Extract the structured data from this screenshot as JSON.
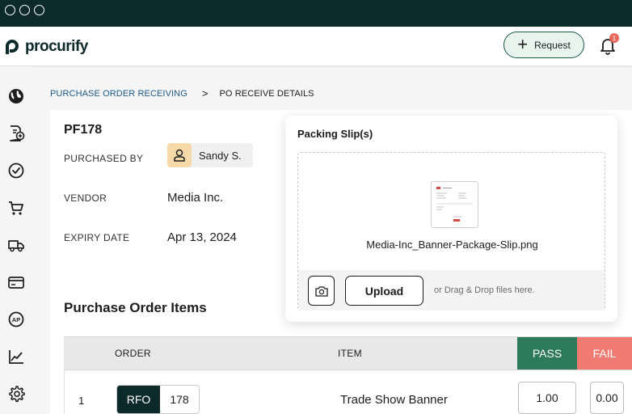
{
  "header": {
    "brand": "procurify",
    "request_label": "Request",
    "notification_count": "1",
    "colors": {
      "titlebar": "#0d2a2b",
      "accent": "#1c5945"
    }
  },
  "sidebar": {
    "items": [
      {
        "icon": "globe-icon"
      },
      {
        "icon": "add-document-icon"
      },
      {
        "icon": "check-circle-icon"
      },
      {
        "icon": "cart-icon"
      },
      {
        "icon": "truck-icon"
      },
      {
        "icon": "credit-card-icon"
      },
      {
        "icon": "ap-icon"
      },
      {
        "icon": "chart-icon"
      },
      {
        "icon": "gear-icon"
      }
    ]
  },
  "breadcrumb": {
    "parent": "PURCHASE ORDER RECEIVING",
    "separator": ">",
    "current": "PO RECEIVE DETAILS"
  },
  "po": {
    "number": "PF178",
    "purchased_by_label": "PURCHASED BY",
    "purchased_by": "Sandy S.",
    "vendor_label": "VENDOR",
    "vendor": "Media Inc.",
    "expiry_label": "EXPIRY DATE",
    "expiry": "Apr 13, 2024"
  },
  "packing_slip": {
    "title": "Packing Slip(s)",
    "file_name": "Media-Inc_Banner-Package-Slip.png",
    "upload_label": "Upload",
    "drag_hint": "or Drag & Drop files here."
  },
  "items": {
    "title": "Purchase Order Items",
    "columns": {
      "order": "ORDER",
      "item": "ITEM",
      "pass": "PASS",
      "fail": "FAIL"
    },
    "pass_color": "#2e7b5b",
    "fail_color": "#ef7b72",
    "rows": [
      {
        "index": "1",
        "order_type": "RFO",
        "order_number": "178",
        "item": "Trade Show Banner",
        "pass_qty": "1.00",
        "fail_qty": "0.00"
      }
    ]
  }
}
